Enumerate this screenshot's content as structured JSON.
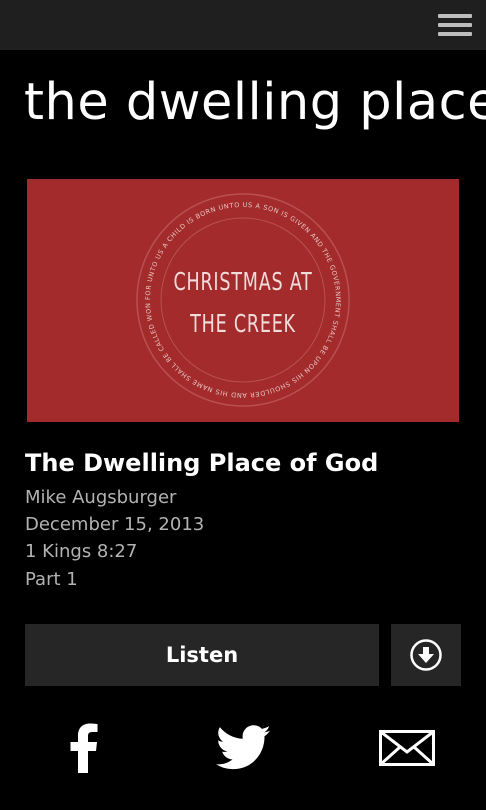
{
  "header": {
    "menu_icon": "hamburger-menu-icon"
  },
  "page": {
    "title": "the dwelling place of God"
  },
  "artwork": {
    "line1": "CHRISTMAS AT",
    "line2": "THE CREEK",
    "ring_text": "FOR UNTO US A CHILD IS BORN UNTO US A SON IS GIVEN AND THE GOVERNMENT SHALL BE UPON HIS SHOULDER AND HIS NAME SHALL BE CALLED WONDERFUL COUNSELOR THE MIGHTY GOD THE EVERLASTING FATHER THE PRINCE OF PEACE",
    "background_color": "#a32b2b"
  },
  "sermon": {
    "title": "The Dwelling Place of God",
    "speaker": "Mike Augsburger",
    "date": "December 15, 2013",
    "scripture": "1 Kings 8:27",
    "part": "Part 1"
  },
  "actions": {
    "listen_label": "Listen",
    "download_icon": "download-icon"
  },
  "share": {
    "icons": [
      "facebook-icon",
      "twitter-icon",
      "email-icon"
    ]
  }
}
